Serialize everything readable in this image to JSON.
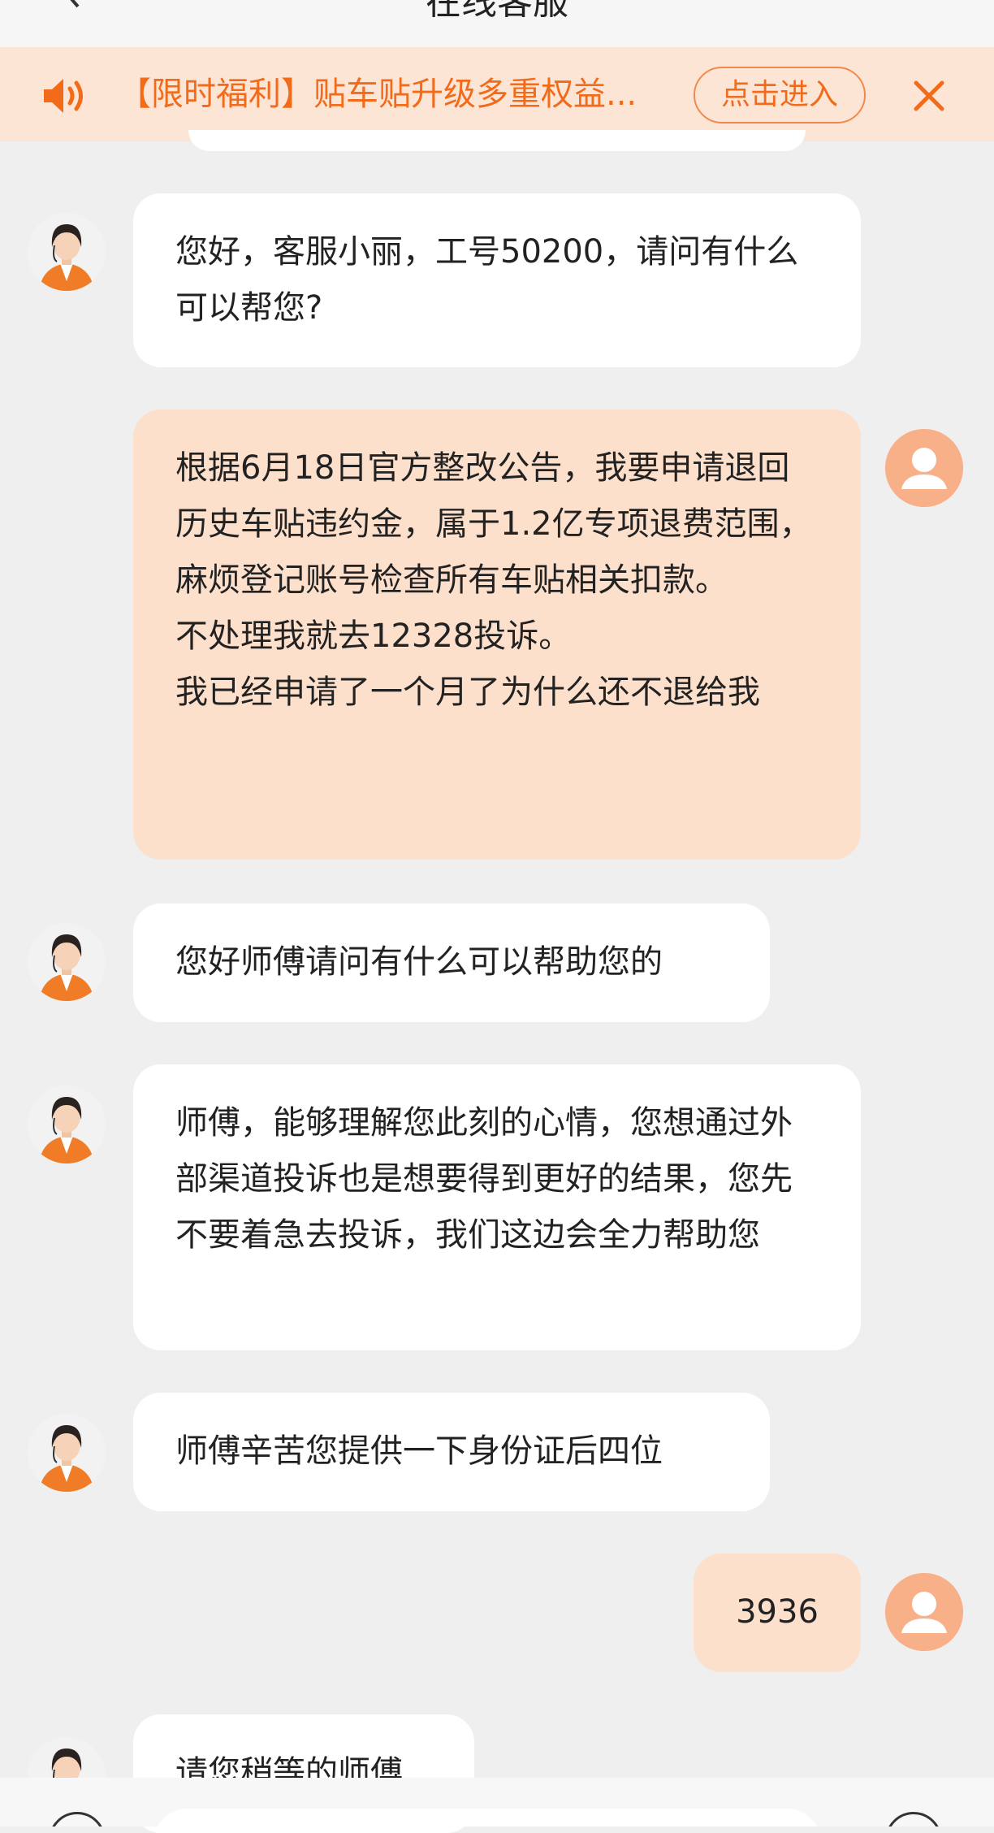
{
  "header": {
    "title": "在线客服"
  },
  "notice": {
    "text": "【限时福利】贴车贴升级多重权益...",
    "enter_label": "点击进入",
    "accent": "#f26b1a"
  },
  "messages": [
    {
      "sender": "agent",
      "text": "您好，客服小丽，工号50200，请问有什么可以帮您?"
    },
    {
      "sender": "user",
      "text": "根据6月18日官方整改公告，我要申请退回历史车贴违约金，属于1.2亿专项退费范围，麻烦登记账号检查所有车贴相关扣款。\n不处理我就去12328投诉。\n我已经申请了一个月了为什么还不退给我"
    },
    {
      "sender": "agent",
      "text": "您好师傅请问有什么可以帮助您的"
    },
    {
      "sender": "agent",
      "text": "师傅，能够理解您此刻的心情，您想通过外部渠道投诉也是想要得到更好的结果，您先不要着急去投诉，我们这边会全力帮助您"
    },
    {
      "sender": "agent",
      "text": "师傅辛苦您提供一下身份证后四位"
    },
    {
      "sender": "user",
      "text": "3936"
    },
    {
      "sender": "agent",
      "text": "请您稍等的师傅"
    }
  ],
  "colors": {
    "background": "#efefef",
    "notice_bg": "#fde5d6",
    "user_bubble": "#fde0cc",
    "agent_bubble": "#ffffff",
    "user_avatar": "#f7b088"
  }
}
